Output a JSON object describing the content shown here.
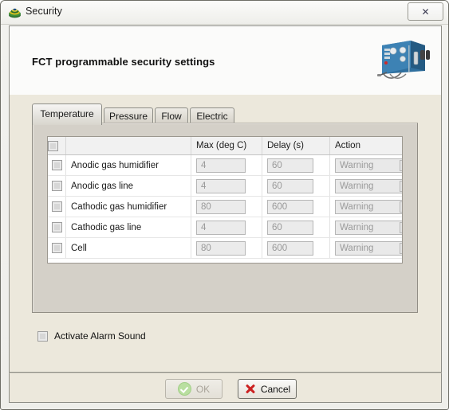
{
  "window": {
    "title": "Security",
    "app_icon": "security-disc-icon",
    "close_label": "✕"
  },
  "header": {
    "title": "FCT programmable security settings",
    "device_image": "fuel-cell-test-station-photo"
  },
  "tabs": [
    {
      "label": "Temperature",
      "active": true
    },
    {
      "label": "Pressure",
      "active": false
    },
    {
      "label": "Flow",
      "active": false
    },
    {
      "label": "Electric",
      "active": false
    }
  ],
  "grid": {
    "columns": [
      "",
      "",
      "Max (deg C)",
      "Delay (s)",
      "Action"
    ],
    "select_all_checked": false,
    "rows": [
      {
        "checked": false,
        "name": "Anodic gas humidifier",
        "max": "4",
        "delay": "60",
        "action": "Warning"
      },
      {
        "checked": false,
        "name": "Anodic gas line",
        "max": "4",
        "delay": "60",
        "action": "Warning"
      },
      {
        "checked": false,
        "name": "Cathodic gas humidifier",
        "max": "80",
        "delay": "600",
        "action": "Warning"
      },
      {
        "checked": false,
        "name": "Cathodic gas line",
        "max": "4",
        "delay": "60",
        "action": "Warning"
      },
      {
        "checked": false,
        "name": "Cell",
        "max": "80",
        "delay": "600",
        "action": "Warning"
      }
    ]
  },
  "alarm": {
    "label": "Activate Alarm Sound",
    "checked": false
  },
  "buttons": {
    "ok": "OK",
    "cancel": "Cancel",
    "ok_enabled": false
  },
  "colors": {
    "body_beige": "#ece8dc",
    "panel_gray": "#d4d0c8",
    "grid_white": "#ffffff",
    "ok_green": "#b9dfa0",
    "cancel_red": "#cc2222"
  }
}
